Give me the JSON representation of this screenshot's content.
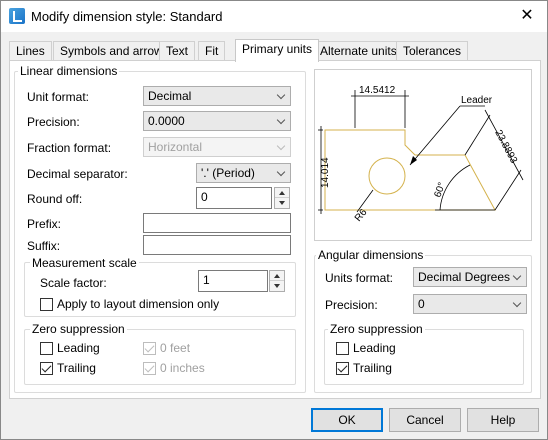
{
  "window": {
    "title": "Modify dimension style: Standard",
    "close_glyph": "✕"
  },
  "tabs": [
    {
      "label": "Lines"
    },
    {
      "label": "Symbols and arrows"
    },
    {
      "label": "Text"
    },
    {
      "label": "Fit"
    },
    {
      "label": "Primary units",
      "active": true
    },
    {
      "label": "Alternate units"
    },
    {
      "label": "Tolerances"
    }
  ],
  "linear": {
    "group_label": "Linear dimensions",
    "unit_format": {
      "label": "Unit format:",
      "value": "Decimal"
    },
    "precision": {
      "label": "Precision:",
      "value": "0.0000"
    },
    "fraction_format": {
      "label": "Fraction format:",
      "value": "Horizontal"
    },
    "decimal_separator": {
      "label": "Decimal separator:",
      "value": "'.' (Period)"
    },
    "round_off": {
      "label": "Round off:",
      "value": "0"
    },
    "prefix": {
      "label": "Prefix:",
      "value": ""
    },
    "suffix": {
      "label": "Suffix:",
      "value": ""
    }
  },
  "measurement_scale": {
    "group_label": "Measurement scale",
    "scale_factor": {
      "label": "Scale factor:",
      "value": "1"
    },
    "apply_layout": {
      "label": "Apply to layout dimension only",
      "checked": false
    }
  },
  "zero_suppression_linear": {
    "group_label": "Zero suppression",
    "leading": {
      "label": "Leading",
      "checked": false
    },
    "trailing": {
      "label": "Trailing",
      "checked": true
    },
    "feet": {
      "label": "0 feet",
      "checked": true
    },
    "inches": {
      "label": "0 inches",
      "checked": true
    }
  },
  "preview": {
    "top_dim": "14.5412",
    "left_dim": "14.014",
    "diag_dim": "23.8893",
    "angle": "60°",
    "radius": "R6",
    "leader": "Leader"
  },
  "angular": {
    "group_label": "Angular dimensions",
    "units_format": {
      "label": "Units format:",
      "value": "Decimal Degrees"
    },
    "precision": {
      "label": "Precision:",
      "value": "0"
    }
  },
  "zero_suppression_angular": {
    "group_label": "Zero suppression",
    "leading": {
      "label": "Leading",
      "checked": false
    },
    "trailing": {
      "label": "Trailing",
      "checked": true
    }
  },
  "buttons": {
    "ok": "OK",
    "cancel": "Cancel",
    "help": "Help"
  },
  "colors": {
    "accent": "#0078d7",
    "geometry": "#d4b24c"
  }
}
